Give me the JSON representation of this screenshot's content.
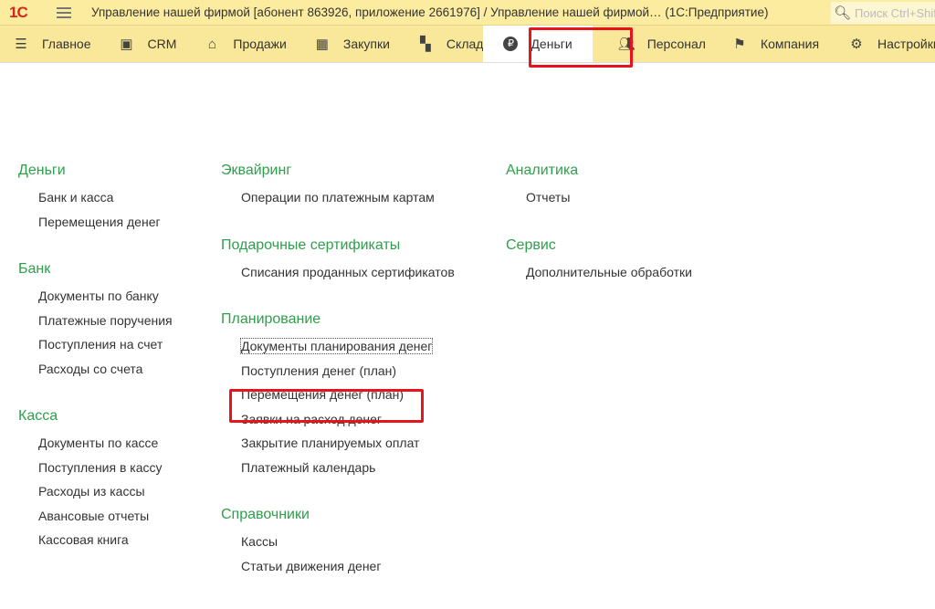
{
  "titlebar": {
    "logo": "1С",
    "title": "Управление нашей фирмой [абонент 863926, приложение 2661976] / Управление нашей фирмой…   (1С:Предприятие)",
    "search_placeholder": "Поиск Ctrl+Shift+F"
  },
  "navbar": {
    "tabs": [
      {
        "label": "Главное",
        "icon": "menu-icon"
      },
      {
        "label": "CRM",
        "icon": "contact-card-icon"
      },
      {
        "label": "Продажи",
        "icon": "basket-icon"
      },
      {
        "label": "Закупки",
        "icon": "cart-icon"
      },
      {
        "label": "Склад",
        "icon": "warehouse-grid-icon"
      },
      {
        "label": "Деньги",
        "icon": "ruble-icon",
        "active": true
      },
      {
        "label": "Персонал",
        "icon": "people-icon"
      },
      {
        "label": "Компания",
        "icon": "flag-icon"
      },
      {
        "label": "Настройки",
        "icon": "gear-icon"
      }
    ]
  },
  "columns": [
    [
      {
        "title": "Деньги",
        "items": [
          "Банк и касса",
          "Перемещения денег"
        ]
      },
      {
        "title": "Банк",
        "items": [
          "Документы по банку",
          "Платежные поручения",
          "Поступления на счет",
          "Расходы со счета"
        ]
      },
      {
        "title": "Касса",
        "items": [
          "Документы по кассе",
          "Поступления в кассу",
          "Расходы из кассы",
          "Авансовые отчеты",
          "Кассовая книга"
        ]
      }
    ],
    [
      {
        "title": "Эквайринг",
        "items": [
          "Операции по платежным картам"
        ]
      },
      {
        "title": "Подарочные сертификаты",
        "items": [
          "Списания проданных сертификатов"
        ]
      },
      {
        "title": "Планирование",
        "items": [
          "Документы планирования денег",
          "Поступления денег (план)",
          "Перемещения денег (план)",
          "Заявки на расход денег",
          "Закрытие планируемых оплат",
          "Платежный календарь"
        ]
      },
      {
        "title": "Справочники",
        "items": [
          "Кассы",
          "Статьи движения денег"
        ]
      }
    ],
    [
      {
        "title": "Аналитика",
        "items": [
          "Отчеты"
        ]
      },
      {
        "title": "Сервис",
        "items": [
          "Дополнительные обработки"
        ]
      }
    ]
  ],
  "colors": {
    "heading": "#2ea04a",
    "highlight": "#e8141c",
    "bar": "#f9e89a"
  }
}
